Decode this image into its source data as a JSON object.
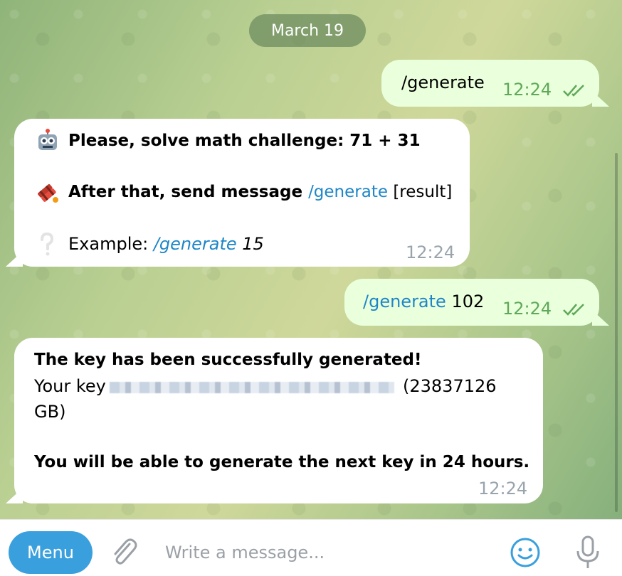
{
  "date": "March 19",
  "messages": {
    "out1": {
      "command": "/generate",
      "time": "12:24"
    },
    "in1": {
      "line1": "Please, solve math challenge: 71 + 31",
      "line2_prefix": "After that, send message ",
      "line2_command": "/generate",
      "line2_suffix": " [result]",
      "line3_prefix": "Example: ",
      "line3_command": "/generate",
      "line3_suffix": " 15",
      "time": "12:24"
    },
    "out2": {
      "command": "/generate",
      "arg": " 102",
      "time": "12:24"
    },
    "in2": {
      "line1": "The key has been successfully generated!",
      "line2_prefix": "Your key",
      "line2_suffix": "(23837126",
      "line3": "GB)",
      "line4": "You will be able to generate the next key in 24 hours.",
      "time": "12:24"
    }
  },
  "composer": {
    "menu_label": "Menu",
    "placeholder": "Write a message..."
  },
  "icons": {
    "robot": "robot-icon",
    "dynamite": "dynamite-icon",
    "question": "question-icon",
    "attach": "paperclip-icon",
    "emoji": "emoji-icon",
    "mic": "microphone-icon",
    "read": "double-check-icon"
  },
  "colors": {
    "outgoing_bubble": "#eaffdc",
    "incoming_bubble": "#ffffff",
    "link": "#1e86c8",
    "menu_button": "#3aa0dd",
    "outgoing_time": "#5fa85a"
  }
}
